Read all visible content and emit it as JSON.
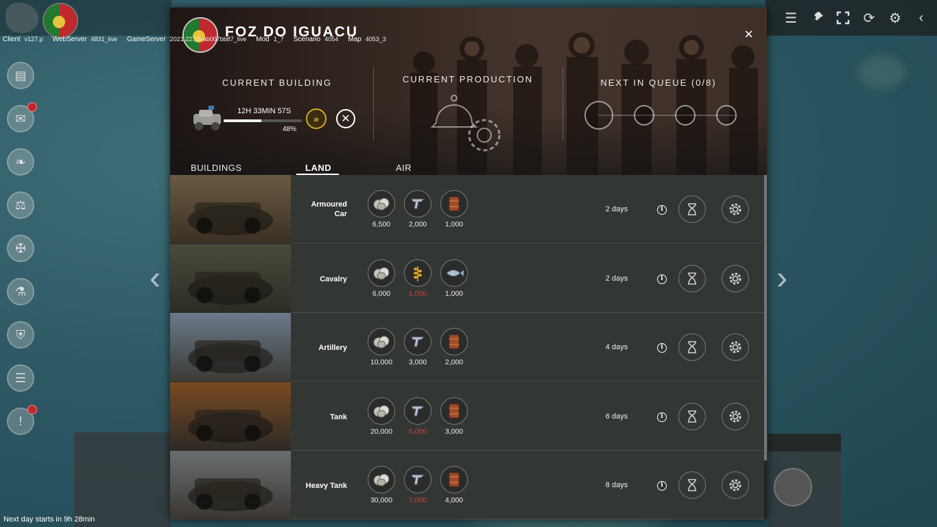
{
  "debug_bar": {
    "client_label": "Client",
    "client_value": "v127.p",
    "webserver_label": "WebServer",
    "webserver_value": "4831_live",
    "gameserver_label": "GameServer",
    "gameserver_value": "2021.22.15-ab007bb87_live",
    "mod_label": "Mod",
    "mod_value": "1_7",
    "scenario_label": "Scenario",
    "scenario_value": "4054",
    "map_label": "Map",
    "map_value": "4053_3"
  },
  "modal": {
    "city_name": "FOZ DO IGUACU",
    "close_label": "×",
    "current_building_title": "CURRENT BUILDING",
    "current_building_time": "12H 33MIN 57S",
    "current_building_progress": 0.48,
    "current_building_pct": "48%",
    "current_production_title": "CURRENT PRODUCTION",
    "next_in_queue_title": "NEXT IN QUEUE (0/8)",
    "tabs": [
      {
        "label": "BUILDINGS",
        "active": false
      },
      {
        "label": "LAND",
        "active": true
      },
      {
        "label": "AIR",
        "active": false
      }
    ],
    "units": [
      {
        "name": "Armoured Car",
        "days": "2 days",
        "resources": [
          {
            "icon": "coins-icon",
            "value": "6,500",
            "short": false
          },
          {
            "icon": "steel-icon",
            "value": "2,000",
            "short": false
          },
          {
            "icon": "oil-barrel-icon",
            "value": "1,000",
            "short": false
          }
        ]
      },
      {
        "name": "Cavalry",
        "days": "2 days",
        "resources": [
          {
            "icon": "coins-icon",
            "value": "6,000",
            "short": false
          },
          {
            "icon": "grain-icon",
            "value": "1,000",
            "short": true
          },
          {
            "icon": "fish-icon",
            "value": "1,000",
            "short": false
          }
        ]
      },
      {
        "name": "Artillery",
        "days": "4 days",
        "resources": [
          {
            "icon": "coins-icon",
            "value": "10,000",
            "short": false
          },
          {
            "icon": "steel-icon",
            "value": "3,000",
            "short": false
          },
          {
            "icon": "oil-barrel-icon",
            "value": "2,000",
            "short": false
          }
        ]
      },
      {
        "name": "Tank",
        "days": "6 days",
        "resources": [
          {
            "icon": "coins-icon",
            "value": "20,000",
            "short": false
          },
          {
            "icon": "steel-icon",
            "value": "5,000",
            "short": true
          },
          {
            "icon": "oil-barrel-icon",
            "value": "3,000",
            "short": false
          }
        ]
      },
      {
        "name": "Heavy Tank",
        "days": "8 days",
        "resources": [
          {
            "icon": "coins-icon",
            "value": "30,000",
            "short": false
          },
          {
            "icon": "steel-icon",
            "value": "7,000",
            "short": true
          },
          {
            "icon": "oil-barrel-icon",
            "value": "4,000",
            "short": false
          }
        ]
      }
    ]
  },
  "status": {
    "next_day": "Next day starts in 9h 28min"
  },
  "colors": {
    "accent_gold": "#d6a824",
    "shortage_red": "#e03a32",
    "badge_red": "#c0282d"
  }
}
